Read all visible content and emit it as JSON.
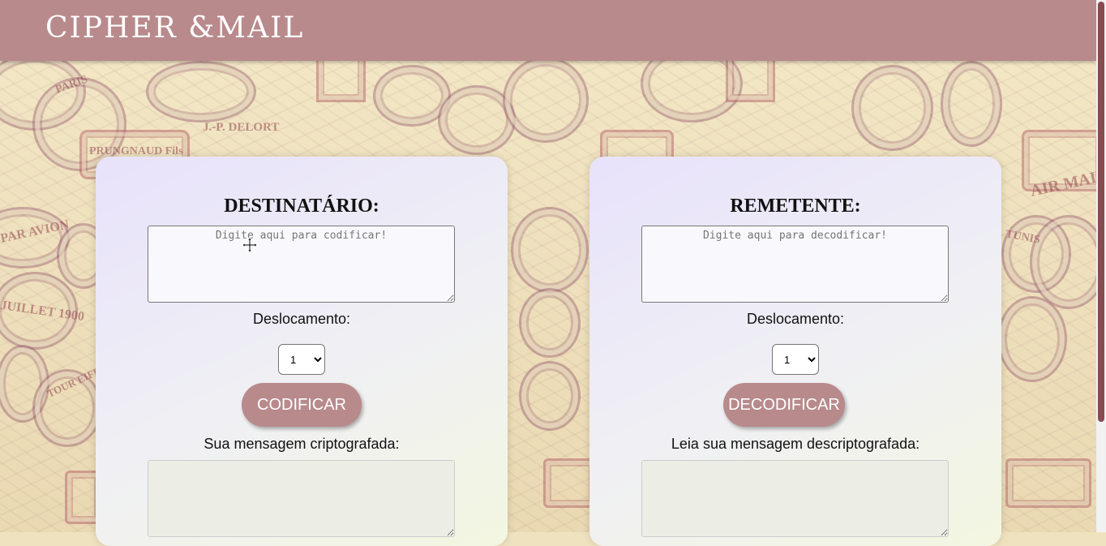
{
  "header": {
    "logo": "CIPHER &MAIL"
  },
  "background_stamps": {
    "s1": "PARIS",
    "s2": "J.-P. DELORT",
    "s3": "PRUNGNAUD Fils",
    "s4": "AIR MAIL",
    "s5": "PAR AVION",
    "s6": "JUILLET 1900",
    "s7": "TUNIS",
    "s8": "TOUR EIFFEL"
  },
  "encode_card": {
    "title": "DESTINATÁRIO:",
    "input_placeholder": "Digite aqui para codificar!",
    "input_value": "",
    "shift_label": "Deslocamento:",
    "shift_value": "1",
    "button_label": "CODIFICAR",
    "result_label": "Sua mensagem criptografada:",
    "result_value": ""
  },
  "decode_card": {
    "title": "REMETENTE:",
    "input_placeholder": "Digite aqui para decodificar!",
    "input_value": "",
    "shift_label": "Deslocamento:",
    "shift_value": "1",
    "button_label": "DECODIFICAR",
    "result_label": "Leia sua mensagem descriptografada:",
    "result_value": ""
  },
  "colors": {
    "header": "#b88a8c",
    "button": "#b88a8c",
    "scroll_thumb": "#8a4a4f"
  },
  "icons": {
    "cursor": "move-cursor-icon"
  }
}
